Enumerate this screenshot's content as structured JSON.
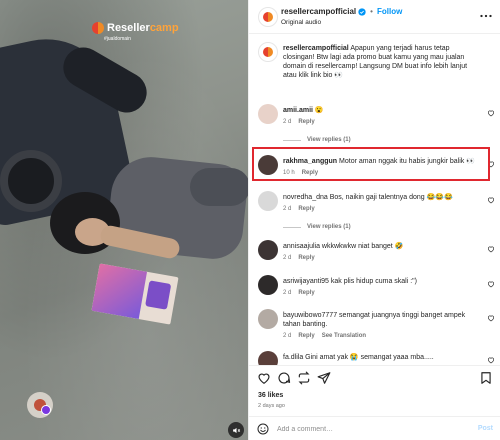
{
  "media": {
    "brand_text_main": "Reseller",
    "brand_text_accent": "camp",
    "brand_tagline": "#jualdomain"
  },
  "header": {
    "username": "resellercampofficial",
    "separator": "•",
    "follow_label": "Follow",
    "audio_label": "Original audio"
  },
  "caption": {
    "username": "resellercampofficial",
    "text": " Apapun yang terjadi harus tetap closingan! Btw lagi ada promo buat kamu yang mau jualan domain di resellercamp! Langsung DM buat info lebih lanjut atau klik link bio 👀"
  },
  "comments": [
    {
      "username": "amii.amii",
      "text": " 😮",
      "time": "2 d",
      "reply": "Reply",
      "view_replies": "View replies (1)"
    },
    {
      "username": "rakhma_anggun",
      "text": " Motor aman nggak itu habis jungkir balik 👀",
      "time": "10 h",
      "reply": "Reply"
    },
    {
      "username": "novredha_dna",
      "text": " Bos, naikin gaji talentnya dong 😂😂😂",
      "time": "2 d",
      "reply": "Reply",
      "view_replies": "View replies (1)"
    },
    {
      "username": "annisaajulia",
      "text": " wkkwkwkw niat banget 🤣",
      "time": "2 d",
      "reply": "Reply"
    },
    {
      "username": "asriwijayanti95",
      "text": " kak plis hidup cuma skali :\")",
      "time": "2 d",
      "reply": "Reply"
    },
    {
      "username": "bayuwibowo7777",
      "text": " semangat juangnya tinggi banget ampek tahan banting.",
      "time": "2 d",
      "reply": "Reply",
      "translate": "See Translation"
    },
    {
      "username": "fa.dlila",
      "text": " Gini amat yak 😭 semangat yaaa mba.....",
      "time": "",
      "reply": ""
    }
  ],
  "likes": "36 likes",
  "date": "2 days ago",
  "add_comment": {
    "placeholder": "Add a comment…",
    "post_label": "Post"
  },
  "colors": {
    "accent_blue": "#0095f6",
    "highlight_red": "#e0282f",
    "muted_text": "#737373"
  }
}
